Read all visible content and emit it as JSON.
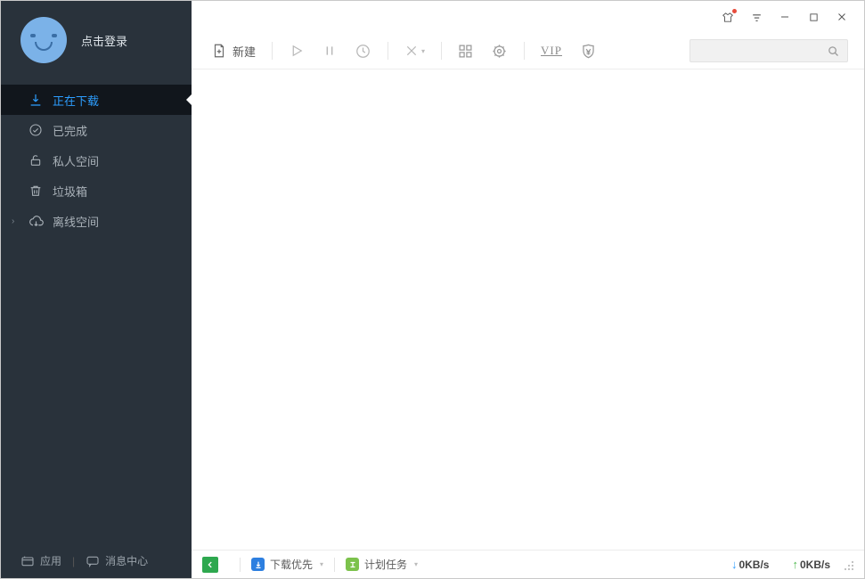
{
  "sidebar": {
    "login_label": "点击登录",
    "items": [
      {
        "label": "正在下载"
      },
      {
        "label": "已完成"
      },
      {
        "label": "私人空间"
      },
      {
        "label": "垃圾箱"
      },
      {
        "label": "离线空间"
      }
    ],
    "footer": {
      "apps_label": "应用",
      "messages_label": "消息中心"
    }
  },
  "toolbar": {
    "new_label": "新建",
    "vip_label": "VIP"
  },
  "statusbar": {
    "priority_label": "下载优先",
    "schedule_label": "计划任务",
    "down_speed": "0KB/s",
    "up_speed": "0KB/s"
  }
}
